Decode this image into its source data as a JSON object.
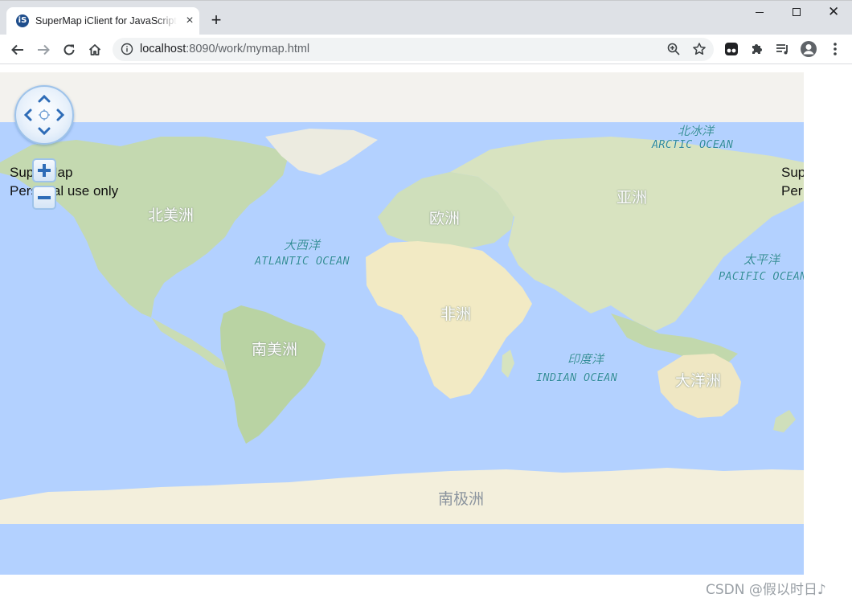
{
  "browser": {
    "tab_title": "SuperMap iClient for JavaScript",
    "favicon_text": "iS",
    "close_glyph": "×",
    "newtab_glyph": "+",
    "window_close_glyph": "✕",
    "url_host": "localhost",
    "url_path": ":8090/work/mymap.html",
    "icons": {
      "back": "back-arrow-icon",
      "forward": "forward-arrow-icon",
      "reload": "reload-icon",
      "home": "home-icon",
      "info": "info-icon",
      "zoom": "zoom-icon",
      "bookmark": "star-icon",
      "extensions": [
        "tampermonkey-icon",
        "puzzle-icon",
        "media-queue-icon",
        "profile-icon",
        "kebab-menu-icon"
      ]
    }
  },
  "map": {
    "colors": {
      "ocean": "#b3d1ff",
      "land": "#f0ecd0",
      "vegetation": "#b8d4a6",
      "polar": "#f3efdc",
      "control_accent": "#2e6cb7"
    },
    "attribution": {
      "line1": "SuperMap",
      "line2": "Personal use only",
      "line1_right": "Sup",
      "line2_right": "Per"
    },
    "labels": {
      "north_america": "北美洲",
      "south_america": "南美洲",
      "europe": "欧洲",
      "africa": "非洲",
      "asia": "亚洲",
      "oceania": "大洋洲",
      "antarctica": "南极洲",
      "arctic_cn": "北冰洋",
      "arctic_en": "ARCTIC OCEAN",
      "atlantic_cn": "大西洋",
      "atlantic_en": "ATLANTIC OCEAN",
      "pacific_cn": "太平洋",
      "pacific_en": "PACIFIC OCEAN",
      "indian_cn": "印度洋",
      "indian_en": "INDIAN OCEAN"
    },
    "controls": {
      "pan": [
        "pan-up-icon",
        "pan-left-icon",
        "pan-right-icon",
        "pan-down-icon",
        "pan-center-icon"
      ],
      "zoom_in": "zoom-in-icon",
      "zoom_out": "zoom-out-icon"
    }
  },
  "watermark": "CSDN @假以时日♪"
}
